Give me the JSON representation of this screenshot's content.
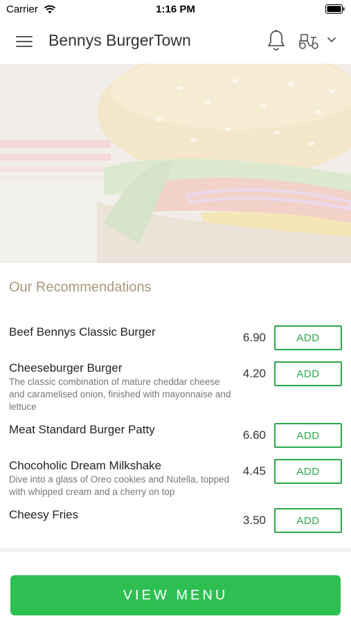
{
  "status_bar": {
    "carrier": "Carrier",
    "time": "1:16 PM"
  },
  "header": {
    "title": "Bennys BurgerTown",
    "icons": [
      "menu-icon",
      "bell-icon",
      "delivery-scooter-icon",
      "chevron-down-icon"
    ]
  },
  "recommendations": {
    "title": "Our Recommendations",
    "add_label": "ADD",
    "items": [
      {
        "name": "Beef Bennys Classic Burger",
        "description": "",
        "price": "6.90"
      },
      {
        "name": "Cheeseburger Burger",
        "description": "The classic combination of mature cheddar cheese and caramelised onion, finished with mayonnaise and lettuce",
        "price": "4.20"
      },
      {
        "name": "Meat Standard Burger Patty",
        "description": "",
        "price": "6.60"
      },
      {
        "name": "Chocoholic Dream Milkshake",
        "description": "Dive into a glass of Oreo cookies and Nutella, topped with whipped cream and a cherry on top",
        "price": "4.45"
      },
      {
        "name": "Cheesy Fries",
        "description": "",
        "price": "3.50"
      }
    ]
  },
  "footer": {
    "view_menu_label": "VIEW MENU"
  },
  "colors": {
    "accent_green": "#2dbf52",
    "add_green": "#2aa64a",
    "section_title": "#a79a79"
  }
}
